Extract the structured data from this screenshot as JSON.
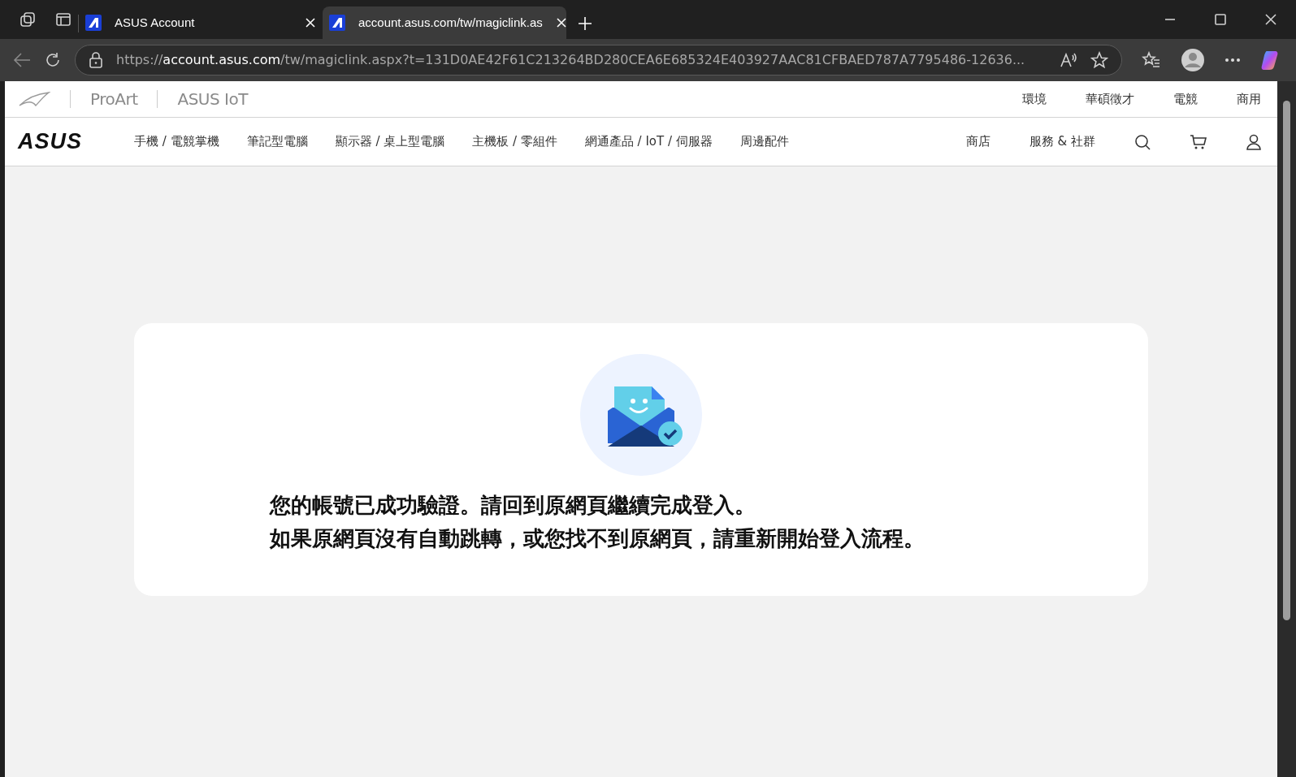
{
  "browser": {
    "tabs": [
      {
        "title": "ASUS Account",
        "selected": false
      },
      {
        "title": "account.asus.com/tw/magiclink.as",
        "selected": true
      }
    ],
    "address": {
      "scheme": "https://",
      "host": "account.asus.com",
      "path": "/tw/magiclink.aspx?t=131D0AE42F61C213264BD280CEA6E685324E403927AAC81CFBAED787A7795486-12636..."
    }
  },
  "brand_bar": {
    "brands": [
      "ProArt",
      "ASUS IoT"
    ],
    "links": [
      "環境",
      "華碩徵才",
      "電競",
      "商用"
    ]
  },
  "main_nav": {
    "logo": "ASUS",
    "items": [
      "手機 / 電競掌機",
      "筆記型電腦",
      "顯示器 / 桌上型電腦",
      "主機板 / 零組件",
      "網通產品 / IoT / 伺服器",
      "周邊配件"
    ],
    "right_items": [
      "商店",
      "服務 & 社群"
    ]
  },
  "message": {
    "lines": [
      "您的帳號已成功驗證。請回到原網頁繼續完成登入。",
      "如果原網頁沒有自動跳轉，或您找不到原網頁，請重新開始登入流程。"
    ]
  }
}
